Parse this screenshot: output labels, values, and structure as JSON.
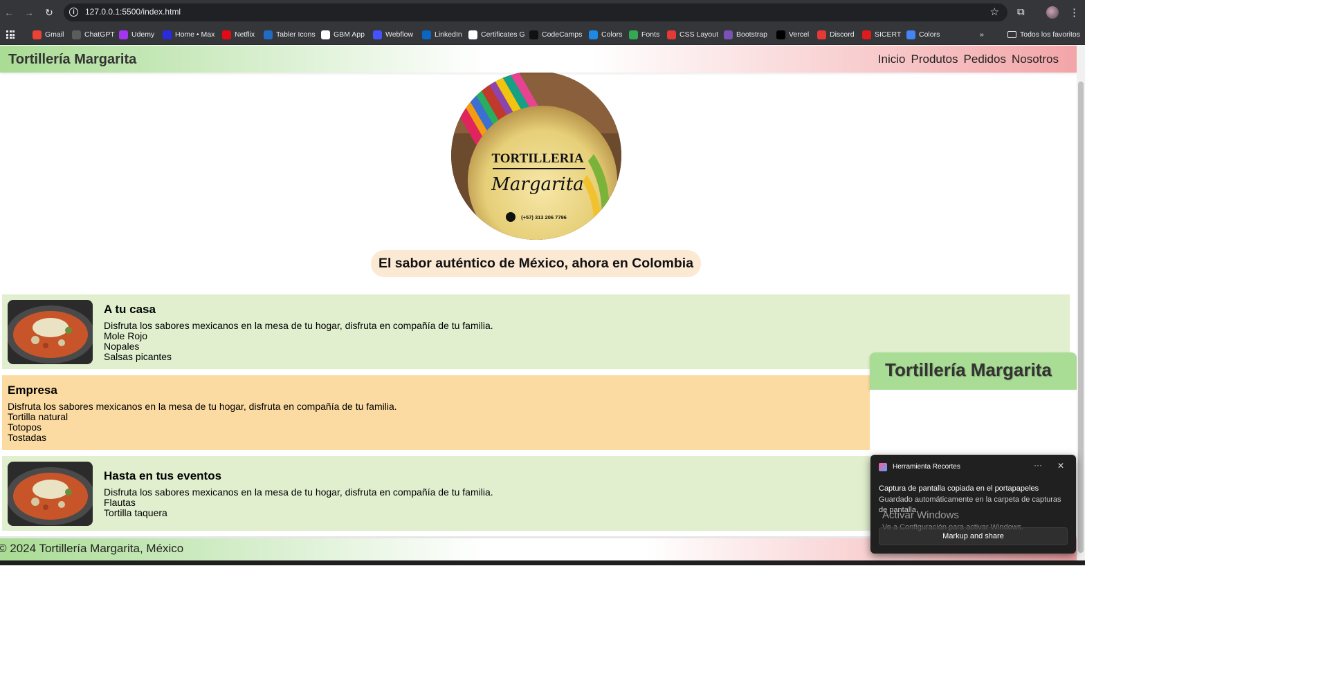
{
  "browser": {
    "url": "127.0.0.1:5500/index.html",
    "bookmarks": [
      {
        "label": "Gmail",
        "icon": "gmail-icon",
        "color": "#ea4335"
      },
      {
        "label": "ChatGPT",
        "icon": "chatgpt-icon",
        "color": "#5c5c5c"
      },
      {
        "label": "Udemy",
        "icon": "udemy-icon",
        "color": "#a435f0"
      },
      {
        "label": "Home • Max",
        "icon": "max-icon",
        "color": "#2a2ae0"
      },
      {
        "label": "Netflix",
        "icon": "netflix-icon",
        "color": "#e50914"
      },
      {
        "label": "Tabler Icons",
        "icon": "tabler-icon",
        "color": "#206bc4"
      },
      {
        "label": "GBM App",
        "icon": "gbm-icon",
        "color": "#ffffff"
      },
      {
        "label": "Webflow",
        "icon": "webflow-icon",
        "color": "#4353ff"
      },
      {
        "label": "LinkedIn",
        "icon": "linkedin-icon",
        "color": "#0a66c2"
      },
      {
        "label": "Certificates G",
        "icon": "google-icon",
        "color": "#ffffff"
      },
      {
        "label": "CodeCamps",
        "icon": "codecamps-icon",
        "color": "#111111"
      },
      {
        "label": "Colors",
        "icon": "colors-icon",
        "color": "#1e88e5"
      },
      {
        "label": "Fonts",
        "icon": "fonts-icon",
        "color": "#34a853"
      },
      {
        "label": "CSS Layout",
        "icon": "css-layout-icon",
        "color": "#e53935"
      },
      {
        "label": "Bootstrap",
        "icon": "bootstrap-icon",
        "color": "#7952b3"
      },
      {
        "label": "Vercel",
        "icon": "vercel-icon",
        "color": "#000000"
      },
      {
        "label": "Discord",
        "icon": "discord-icon",
        "color": "#e53935"
      },
      {
        "label": "SICERT",
        "icon": "sicert-icon",
        "color": "#e01b1b"
      },
      {
        "label": "Colors",
        "icon": "colors2-icon",
        "color": "#4285f4"
      }
    ],
    "all_bookmarks": "Todos los favoritos"
  },
  "site": {
    "brand": "Tortillería Margarita",
    "nav": [
      "Inicio",
      "Produtos",
      "Pedidos",
      "Nosotros"
    ],
    "logo": {
      "line1": "TORTILLERIA",
      "line2": "Margarita",
      "phone": "(+57) 313 206 7796"
    },
    "tagline": "El sabor auténtico de México, ahora en Colombia",
    "cards": [
      {
        "title": "A tu casa",
        "description": "Disfruta los sabores mexicanos en la mesa de tu hogar, disfruta en compañía de tu familia.",
        "items": [
          "Mole Rojo",
          "Nopales",
          "Salsas picantes"
        ]
      },
      {
        "title": "Empresa",
        "description": "Disfruta los sabores mexicanos en la mesa de tu hogar, disfruta en compañía de tu familia.",
        "items": [
          "Tortilla natural",
          "Totopos",
          "Tostadas"
        ]
      },
      {
        "title": "Hasta en tus eventos",
        "description": "Disfruta los sabores mexicanos en la mesa de tu hogar, disfruta en compañía de tu familia.",
        "items": [
          "Flautas",
          "Tortilla taquera"
        ]
      }
    ],
    "side_widget": "Tortillería Margarita",
    "footer": "© 2024 Tortillería Margarita, México"
  },
  "toast": {
    "app": "Herramienta Recortes",
    "title": "Captura de pantalla copiada en el portapapeles",
    "body": "Guardado automáticamente en la carpeta de capturas de pantalla.",
    "watermark_title": "Activar Windows",
    "watermark_sub": "Ve a Configuración para activar Windows.",
    "button": "Markup and share"
  },
  "colors": {
    "header_green": "#a9dc94",
    "header_pink": "#f3a5a8",
    "card_green": "#e1efcf",
    "card_orange": "#fbdba1",
    "tagline_bg": "#fbe9d4"
  }
}
